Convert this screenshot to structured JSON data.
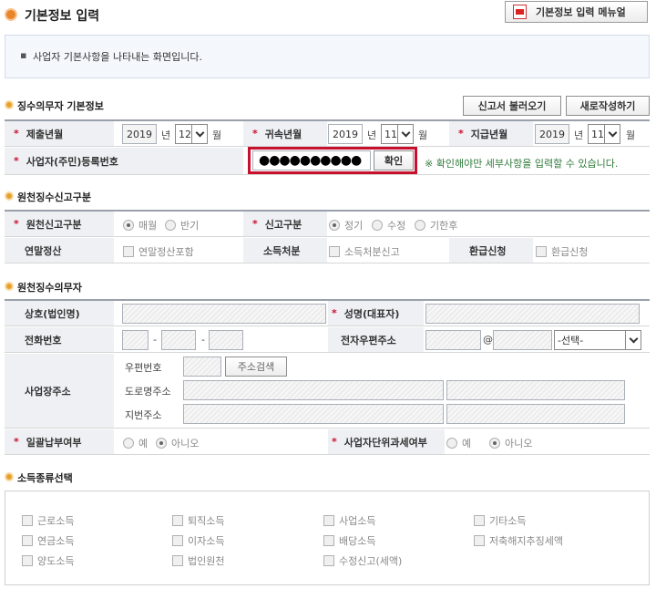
{
  "header": {
    "title": "기본정보 입력",
    "manual_button": "기본정보 입력 메뉴얼"
  },
  "info": {
    "text": "사업자 기본사항을 나타내는 화면입니다."
  },
  "section1": {
    "title": "징수의무자 기본정보",
    "load_button": "신고서 불러오기",
    "new_button": "새로작성하기",
    "submit_ym": {
      "label": "제출년월",
      "year": "2019",
      "year_unit": "년",
      "month": "12",
      "month_unit": "월"
    },
    "attrib_ym": {
      "label": "귀속년월",
      "year": "2019",
      "year_unit": "년",
      "month": "11",
      "month_unit": "월"
    },
    "pay_ym": {
      "label": "지급년월",
      "year": "2019",
      "year_unit": "년",
      "month": "11",
      "month_unit": "월"
    },
    "rrn": {
      "label": "사업자(주민)등록번호",
      "value": "●●●●●●●●●●",
      "confirm": "확인",
      "note": "※ 확인해야만 세부사항을 입력할 수 있습니다."
    }
  },
  "section2": {
    "title": "원천징수신고구분",
    "report_type": {
      "label": "원천신고구분",
      "options": [
        "매월",
        "반기"
      ]
    },
    "filing_type": {
      "label": "신고구분",
      "options": [
        "정기",
        "수정",
        "기한후"
      ]
    },
    "yearend": {
      "label": "연말정산",
      "option": "연말정산포함"
    },
    "income_disposal": {
      "label": "소득처분",
      "option": "소득처분신고"
    },
    "refund": {
      "label": "환급신청",
      "option": "환급신청"
    }
  },
  "section3": {
    "title": "원천징수의무자",
    "company_label": "상호(법인명)",
    "name_label": "성명(대표자)",
    "phone_label": "전화번호",
    "phone_sep": "-",
    "email_label": "전자우편주소",
    "email_at": "@",
    "email_select": "-선택-",
    "address_label": "사업장주소",
    "zip_label": "우편번호",
    "zip_button": "주소검색",
    "road_label": "도로명주소",
    "lot_label": "지번주소",
    "lump_label": "일괄납부여부",
    "lump_options": [
      "예",
      "아니오"
    ],
    "unit_label": "사업자단위과세여부",
    "unit_options": [
      "예",
      "아니오"
    ]
  },
  "section4": {
    "title": "소득종류선택",
    "items": [
      "근로소득",
      "퇴직소득",
      "사업소득",
      "기타소득",
      "연금소득",
      "이자소득",
      "배당소득",
      "저축해지추징세액",
      "양도소득",
      "법인원천",
      "수정신고(세액)"
    ]
  }
}
